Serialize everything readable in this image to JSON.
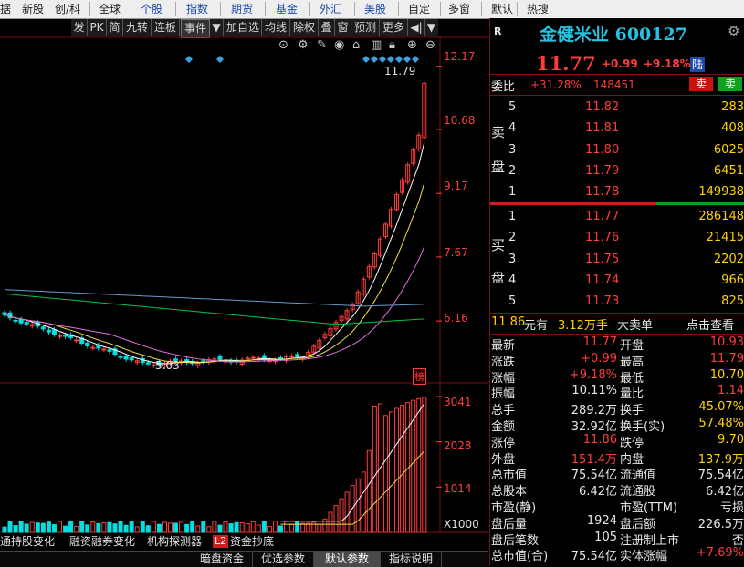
{
  "colors": {
    "up": "#ff3c3c",
    "down": "#00e0e0",
    "ma1": "#ffffff",
    "ma2": "#f0e040",
    "ma3": "#e070e0",
    "ma4": "#00c050",
    "ma5": "#6a9ad0"
  },
  "topnav": {
    "items": [
      "据",
      "新股",
      "创/科",
      "全球",
      "个股",
      "指数",
      "期货",
      "基金",
      "外汇",
      "美股",
      "自定",
      "多窗",
      "默认",
      "热搜"
    ]
  },
  "toolbar": {
    "items": [
      "发",
      "PK",
      "简",
      "九转",
      "连板",
      "事件",
      "▼",
      "加自选",
      "均线",
      "除权",
      "叠",
      "窗",
      "预测",
      "更多",
      "◀|",
      "▼"
    ]
  },
  "icons": [
    "target-icon",
    "gear-icon",
    "pencil-icon",
    "eye-icon",
    "shop-icon",
    "trash-icon",
    "lock-icon",
    "zoom-in-icon",
    "zoom-out-icon"
  ],
  "chart": {
    "price_labels": [
      "12.17",
      "10.68",
      "9.17",
      "7.67",
      "6.16"
    ],
    "high_marker": "11.79",
    "low_marker": "5.03",
    "corner_tag": "榜",
    "volume_labels": [
      "3041",
      "2028",
      "1014",
      "X1000"
    ]
  },
  "bottom_tabs": [
    "通持股变化",
    "融资融券变化",
    "机构探测器",
    "L2",
    "资金抄底"
  ],
  "bottom_bar": [
    "暗盘资金",
    "优选参数",
    "默认参数",
    "指标说明"
  ],
  "panel": {
    "header_tag": "R",
    "name": "金健米业 600127",
    "price": "11.77",
    "change": "+0.99",
    "pct": "+9.18%",
    "badge": "陆",
    "weibi_label": "委比",
    "weibi_pct": "+31.28%",
    "weibi_val": "148451",
    "sell_btn": "卖",
    "buy_btn": "卖",
    "sell_side_label": [
      "卖",
      "盘"
    ],
    "buy_side_label": [
      "买",
      "盘"
    ],
    "asks": [
      {
        "lvl": "5",
        "price": "11.82",
        "vol": "283"
      },
      {
        "lvl": "4",
        "price": "11.81",
        "vol": "408"
      },
      {
        "lvl": "3",
        "price": "11.80",
        "vol": "6025"
      },
      {
        "lvl": "2",
        "price": "11.79",
        "vol": "6451"
      },
      {
        "lvl": "1",
        "price": "11.78",
        "vol": "149938"
      }
    ],
    "bids": [
      {
        "lvl": "1",
        "price": "11.77",
        "vol": "286148"
      },
      {
        "lvl": "2",
        "price": "11.76",
        "vol": "21415"
      },
      {
        "lvl": "3",
        "price": "11.75",
        "vol": "2202"
      },
      {
        "lvl": "4",
        "price": "11.74",
        "vol": "966"
      },
      {
        "lvl": "5",
        "price": "11.73",
        "vol": "825"
      }
    ],
    "bigorder": {
      "price": "11.86",
      "unit1": "元有",
      "qty": "3.12万手",
      "label": "大卖单",
      "link": "点击查看"
    },
    "stats": [
      {
        "k1": "最新",
        "v1": "11.77",
        "c1": "r",
        "k2": "开盘",
        "v2": "10.93",
        "c2": "r"
      },
      {
        "k1": "涨跌",
        "v1": "+0.99",
        "c1": "r",
        "k2": "最高",
        "v2": "11.79",
        "c2": "r"
      },
      {
        "k1": "涨幅",
        "v1": "+9.18%",
        "c1": "r",
        "k2": "最低",
        "v2": "10.70",
        "c2": "y"
      },
      {
        "k1": "振幅",
        "v1": "10.11%",
        "c1": "w",
        "k2": "量比",
        "v2": "1.14",
        "c2": "r"
      },
      {
        "k1": "总手",
        "v1": "289.2万",
        "c1": "w",
        "k2": "换手",
        "v2": "45.07%",
        "c2": "y"
      },
      {
        "k1": "金额",
        "v1": "32.92亿",
        "c1": "w",
        "k2": "换手(实)",
        "v2": "57.48%",
        "c2": "y"
      },
      {
        "k1": "涨停",
        "v1": "11.86",
        "c1": "r",
        "k2": "跌停",
        "v2": "9.70",
        "c2": "y"
      },
      {
        "k1": "外盘",
        "v1": "151.4万",
        "c1": "r",
        "k2": "内盘",
        "v2": "137.9万",
        "c2": "y"
      },
      {
        "k1": "总市值",
        "v1": "75.54亿",
        "c1": "w",
        "k2": "流通值",
        "v2": "75.54亿",
        "c2": "w"
      },
      {
        "k1": "总股本",
        "v1": "6.42亿",
        "c1": "w",
        "k2": "流通股",
        "v2": "6.42亿",
        "c2": "w"
      },
      {
        "k1": "市盈(静)",
        "v1": "",
        "c1": "w",
        "k2": "市盈(TTM)",
        "v2": "亏损",
        "c2": "w"
      },
      {
        "k1": "盘后量",
        "v1": "1924",
        "c1": "w",
        "k2": "盘后额",
        "v2": "226.5万",
        "c2": "w"
      },
      {
        "k1": "盘后笔数",
        "v1": "105",
        "c1": "w",
        "k2": "注册制上市",
        "v2": "否",
        "c2": "w"
      },
      {
        "k1": "总市值(合)",
        "v1": "75.54亿",
        "c1": "w",
        "k2": "实体涨幅",
        "v2": "+7.69%",
        "c2": "r"
      }
    ]
  }
}
